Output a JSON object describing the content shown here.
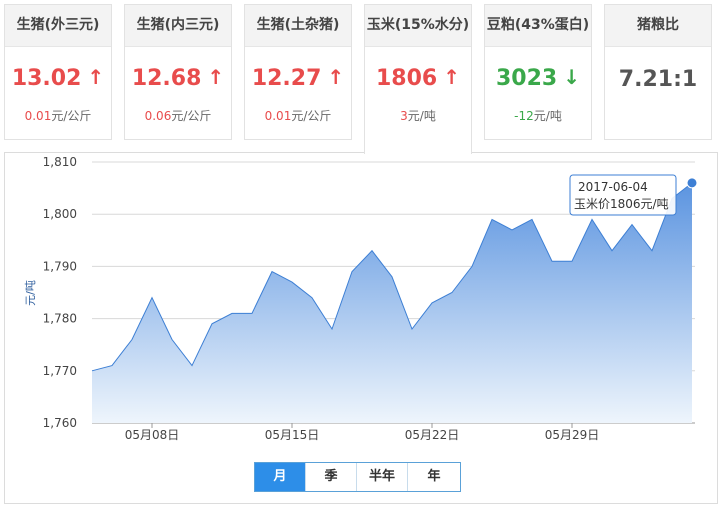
{
  "cards": [
    {
      "name": "生猪(外三元)",
      "price": "13.02",
      "arrow": "↑",
      "trend": "up",
      "change": "0.01",
      "unit": "元/公斤"
    },
    {
      "name": "生猪(内三元)",
      "price": "12.68",
      "arrow": "↑",
      "trend": "up",
      "change": "0.06",
      "unit": "元/公斤"
    },
    {
      "name": "生猪(土杂猪)",
      "price": "12.27",
      "arrow": "↑",
      "trend": "up",
      "change": "0.01",
      "unit": "元/公斤"
    },
    {
      "name": "玉米(15%水分)",
      "price": "1806",
      "arrow": "↑",
      "trend": "up",
      "change": "3",
      "unit": "元/吨"
    },
    {
      "name": "豆粕(43%蛋白)",
      "price": "3023",
      "arrow": "↓",
      "trend": "down",
      "change": "-12",
      "unit": "元/吨"
    },
    {
      "name": "猪粮比",
      "price": "7.21:1",
      "arrow": "",
      "trend": "neutral",
      "change": "",
      "unit": ""
    }
  ],
  "ranges": [
    "月",
    "季",
    "半年",
    "年"
  ],
  "tooltip": {
    "date": "2017-06-04",
    "text": "玉米价1806元/吨"
  },
  "colors": {
    "up": "#e84c4c",
    "down": "#3aa84a",
    "line": "#3d7fd4",
    "area_top": "#5b94e0",
    "area_bottom": "#eef5fc",
    "selected": "#2d8ee8"
  },
  "chart_data": {
    "type": "area",
    "ylabel": "元/吨",
    "ylim": [
      1760,
      1810
    ],
    "yticks": [
      "1,760",
      "1,770",
      "1,780",
      "1,790",
      "1,800",
      "1,810"
    ],
    "ytick_values": [
      1760,
      1770,
      1780,
      1790,
      1800,
      1810
    ],
    "xtick_labels": [
      "05月08日",
      "05月15日",
      "05月22日",
      "05月29日"
    ],
    "xtick_dates": [
      "2017-05-08",
      "2017-05-15",
      "2017-05-22",
      "2017-05-29"
    ],
    "x": [
      "2017-05-05",
      "2017-05-06",
      "2017-05-07",
      "2017-05-08",
      "2017-05-09",
      "2017-05-10",
      "2017-05-11",
      "2017-05-12",
      "2017-05-13",
      "2017-05-14",
      "2017-05-15",
      "2017-05-16",
      "2017-05-17",
      "2017-05-18",
      "2017-05-19",
      "2017-05-20",
      "2017-05-21",
      "2017-05-22",
      "2017-05-23",
      "2017-05-24",
      "2017-05-25",
      "2017-05-26",
      "2017-05-27",
      "2017-05-28",
      "2017-05-29",
      "2017-05-30",
      "2017-05-31",
      "2017-06-01",
      "2017-06-02",
      "2017-06-03",
      "2017-06-04"
    ],
    "values": [
      1770,
      1771,
      1776,
      1784,
      1776,
      1771,
      1779,
      1781,
      1781,
      1789,
      1787,
      1784,
      1778,
      1789,
      1793,
      1788,
      1778,
      1783,
      1785,
      1790,
      1799,
      1797,
      1799,
      1791,
      1791,
      1799,
      1793,
      1798,
      1793,
      1803,
      1806
    ],
    "grid": true
  }
}
